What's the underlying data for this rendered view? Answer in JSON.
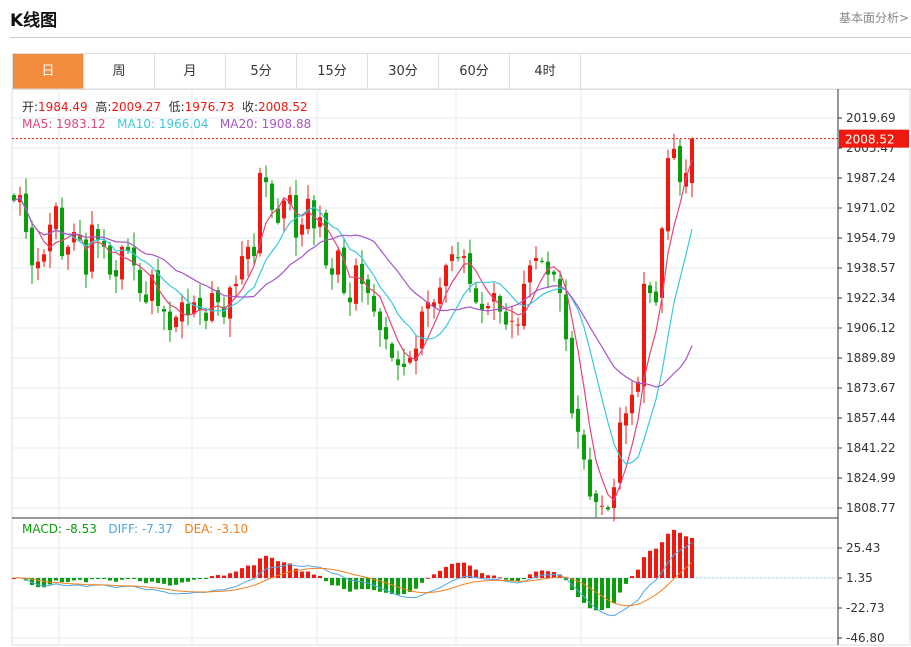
{
  "header": {
    "title": "K线图",
    "link": "基本面分析>"
  },
  "tabs": [
    "日",
    "周",
    "月",
    "5分",
    "15分",
    "30分",
    "60分",
    "4时"
  ],
  "active_tab": 0,
  "ohlc_legend": {
    "open_label": "开:",
    "open": "1984.49",
    "high_label": "高:",
    "high": "2009.27",
    "low_label": "低:",
    "low": "1976.73",
    "close_label": "收:",
    "close": "2008.52"
  },
  "ma_legend": {
    "ma5": "MA5: 1983.12",
    "ma10": "MA10: 1966.04",
    "ma20": "MA20: 1908.88"
  },
  "macd_legend": {
    "macd": "MACD: -8.53",
    "diff": "DIFF: -7.37",
    "dea": "DEA: -3.10"
  },
  "colors": {
    "up": "#f0190f",
    "down": "#0a9e0a",
    "ma5": "#e8457a",
    "ma10": "#3cc8dc",
    "ma20": "#a855c8",
    "diff": "#4da6e8",
    "dea": "#f07f1e",
    "active_tab": "#f28c3c"
  },
  "chart_data": [
    {
      "type": "candlestick",
      "price_ticks": [
        "2019.69",
        "2003.47",
        "1987.24",
        "1971.02",
        "1954.79",
        "1938.57",
        "1922.34",
        "1906.12",
        "1889.89",
        "1873.67",
        "1857.44",
        "1841.22",
        "1824.99",
        "1808.77"
      ],
      "ylim": [
        1808.77,
        2019.69
      ],
      "current_price": "2008.52",
      "close": [
        1975,
        1978,
        1958,
        1940,
        1942,
        1946,
        1962,
        1972,
        1945,
        1950,
        1958,
        1954,
        1935,
        1962,
        1954,
        1950,
        1935,
        1934,
        1950,
        1948,
        1940,
        1925,
        1920,
        1935,
        1918,
        1915,
        1905,
        1912,
        1920,
        1913,
        1920,
        1916,
        1910,
        1925,
        1920,
        1912,
        1928,
        1930,
        1945,
        1950,
        1945,
        1990,
        1985,
        1970,
        1963,
        1975,
        1978,
        1955,
        1962,
        1976,
        1960,
        1966,
        1940,
        1935,
        1948,
        1925,
        1920,
        1940,
        1930,
        1925,
        1915,
        1905,
        1900,
        1890,
        1886,
        1885,
        1890,
        1895,
        1915,
        1920,
        1920,
        1928,
        1940,
        1946,
        1944,
        1945,
        1930,
        1920,
        1916,
        1918,
        1925,
        1915,
        1908,
        1910,
        1908,
        1930,
        1940,
        1944,
        1942,
        1935,
        1935,
        1925,
        1900,
        1860,
        1850,
        1835,
        1815,
        1812,
        1810,
        1808,
        1820,
        1855,
        1860,
        1870,
        1877,
        1930,
        1925,
        1920,
        1960,
        1998,
        2003,
        1985,
        1990,
        2008.52
      ],
      "last_candle": {
        "open": 1984.49,
        "high": 2009.27,
        "low": 1976.73,
        "close": 2008.52
      }
    },
    {
      "type": "macd",
      "ticks": [
        "25.43",
        "1.35",
        "-22.73",
        "-46.80"
      ],
      "ylim": [
        -46.8,
        25.43
      ]
    }
  ]
}
